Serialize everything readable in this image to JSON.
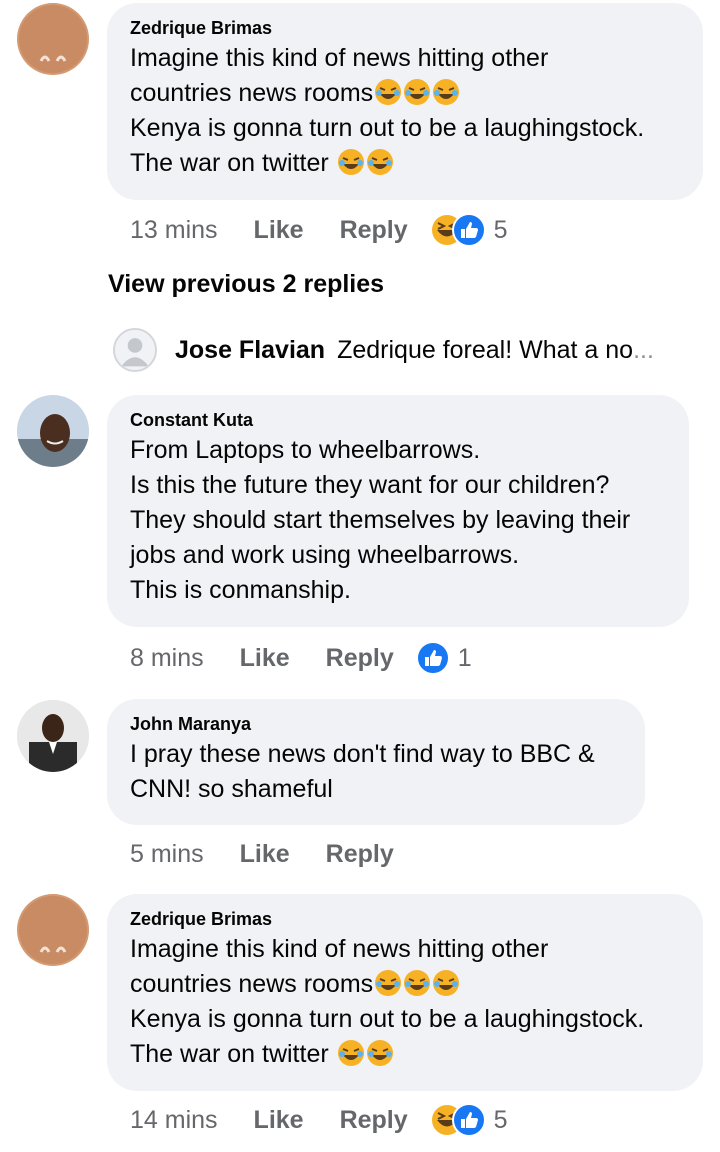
{
  "colors": {
    "bubble": "#f0f2f5",
    "meta_text": "#65676b",
    "like_blue": "#1877f2",
    "haha_yellow": "#f7b125"
  },
  "comments": [
    {
      "author": "Zedrique Brimas",
      "lines": [
        "Imagine this kind of news hitting other",
        "countries news rooms",
        "Kenya is gonna turn out to be a laughingstock.",
        "The war on twitter"
      ],
      "time": "13 mins",
      "like": "Like",
      "reply": "Reply",
      "reaction_count": "5"
    },
    {
      "author": "Constant Kuta",
      "lines": [
        "From Laptops to wheelbarrows.",
        "Is this the future they want for our children?",
        "They should start themselves by leaving their",
        "jobs and work using wheelbarrows.",
        "This is conmanship."
      ],
      "time": "8 mins",
      "like": "Like",
      "reply": "Reply",
      "reaction_count": "1"
    },
    {
      "author": "John Maranya",
      "lines": [
        "I pray these news don't find way to BBC &",
        "CNN! so shameful"
      ],
      "time": "5 mins",
      "like": "Like",
      "reply": "Reply"
    },
    {
      "author": "Zedrique Brimas",
      "lines": [
        "Imagine this kind of news hitting other",
        "countries news rooms",
        "Kenya is gonna turn out to be a laughingstock.",
        "The war on twitter"
      ],
      "time": "14 mins",
      "like": "Like",
      "reply": "Reply",
      "reaction_count": "5"
    }
  ],
  "view_previous": "View previous 2 replies",
  "reply_preview": {
    "author": "Jose Flavian",
    "snippet": "Zedrique foreal! What a no",
    "ellipsis": "..."
  },
  "icons": [
    "avatar",
    "haha-emoji",
    "like-reaction-icon",
    "haha-reaction-icon"
  ]
}
